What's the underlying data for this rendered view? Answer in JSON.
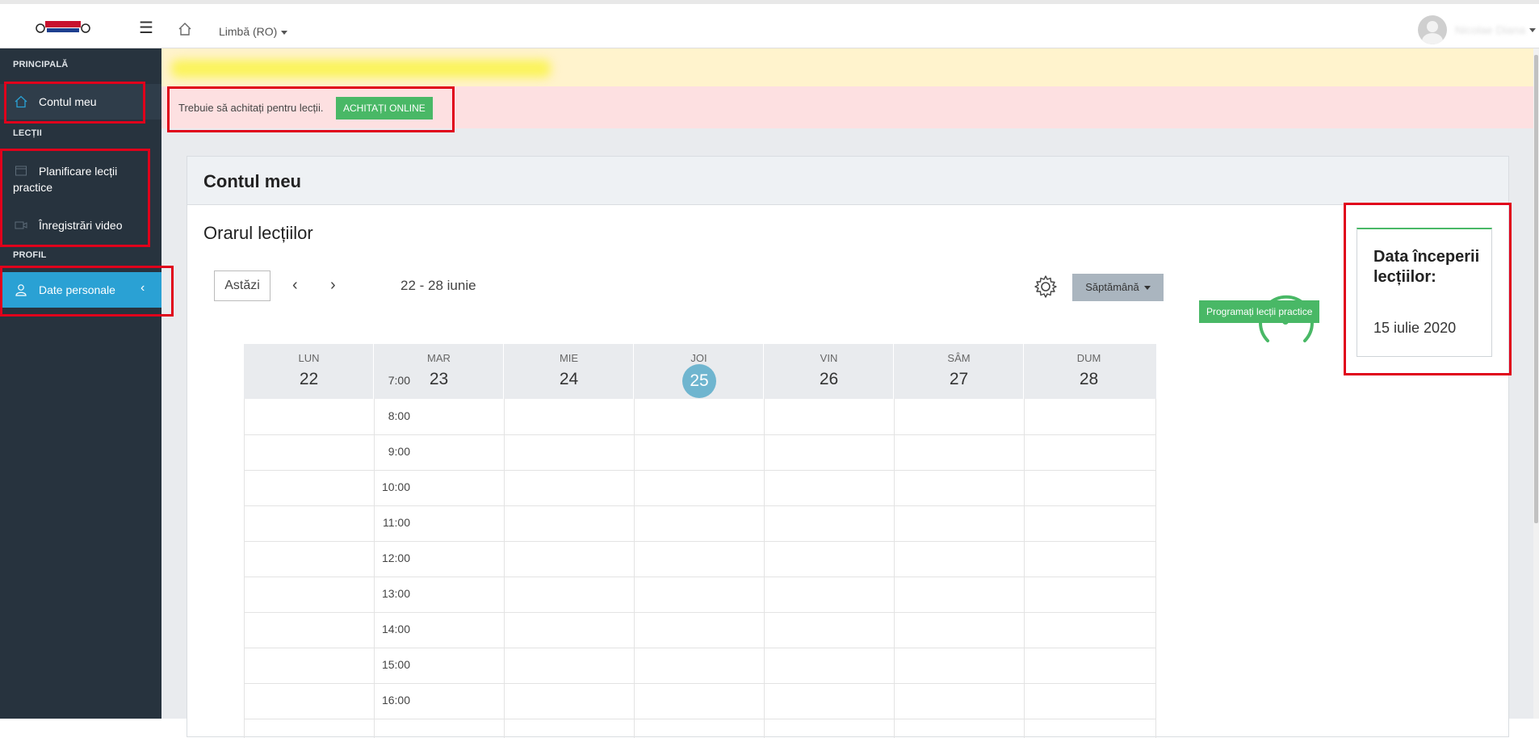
{
  "topbar": {
    "language_label": "Limbă (RO)",
    "username": "Nicolae Diana"
  },
  "sidebar": {
    "sections": [
      {
        "heading": "PRINCIPALĂ"
      },
      {
        "heading": "LECȚII"
      },
      {
        "heading": "PROFIL"
      }
    ],
    "items": [
      {
        "label": "Contul meu",
        "icon": "home-icon"
      },
      {
        "label": "Planificare lecții practice",
        "icon": "calendar-icon"
      },
      {
        "label": "Înregistrări video",
        "icon": "video-icon"
      },
      {
        "label": "Date personale",
        "icon": "user-icon"
      }
    ]
  },
  "alerts": {
    "payment_message": "Trebuie să achitați pentru lecții.",
    "pay_button": "ACHITAȚI ONLINE"
  },
  "card": {
    "title": "Contul meu",
    "schedule_title": "Orarul lecțiilor"
  },
  "calendar": {
    "today_button": "Astăzi",
    "range": "22 - 28 iunie",
    "view_button": "Săptămână",
    "days": [
      {
        "name": "LUN",
        "num": "22"
      },
      {
        "name": "MAR",
        "num": "23"
      },
      {
        "name": "MIE",
        "num": "24"
      },
      {
        "name": "JOI",
        "num": "25"
      },
      {
        "name": "VIN",
        "num": "26"
      },
      {
        "name": "SÂM",
        "num": "27"
      },
      {
        "name": "DUM",
        "num": "28"
      }
    ],
    "today_index": 3,
    "hours": [
      "7:00",
      "8:00",
      "9:00",
      "10:00",
      "11:00",
      "12:00",
      "13:00",
      "14:00",
      "15:00",
      "16:00"
    ]
  },
  "actions": {
    "schedule_button": "Programați lecții practice"
  },
  "start_info": {
    "label": "Data începerii lecțiilor:",
    "date": "15 iulie 2020"
  },
  "colors": {
    "accent": "#2aa1d4",
    "success": "#49b866",
    "sidebar_bg": "#27333e",
    "highlight": "#e0001b"
  }
}
